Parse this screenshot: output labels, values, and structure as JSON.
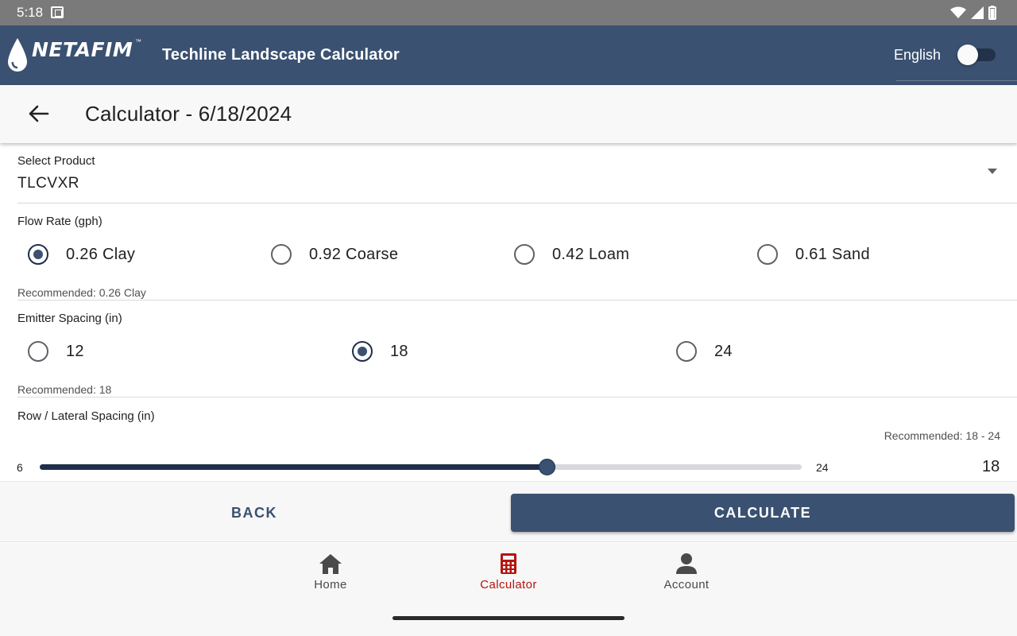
{
  "status_bar": {
    "time": "5:18"
  },
  "app_bar": {
    "logo_text": "NETAFIM",
    "logo_tm": "™",
    "title": "Techline Landscape Calculator",
    "language_label": "English"
  },
  "page": {
    "title": "Calculator - 6/18/2024"
  },
  "product": {
    "label": "Select Product",
    "value": "TLCVXR"
  },
  "flow_rate": {
    "label": "Flow Rate (gph)",
    "options": [
      {
        "label": "0.26 Clay",
        "checked": true
      },
      {
        "label": "0.92 Coarse",
        "checked": false
      },
      {
        "label": "0.42 Loam",
        "checked": false
      },
      {
        "label": "0.61 Sand",
        "checked": false
      }
    ],
    "recommended": "Recommended: 0.26 Clay"
  },
  "emitter_spacing": {
    "label": "Emitter Spacing (in)",
    "options": [
      {
        "label": "12",
        "checked": false
      },
      {
        "label": "18",
        "checked": true
      },
      {
        "label": "24",
        "checked": false
      }
    ],
    "recommended": "Recommended: 18"
  },
  "row_spacing": {
    "label": "Row / Lateral Spacing (in)",
    "recommended": "Recommended: 18 - 24",
    "min": "6",
    "max": "24",
    "value": "18"
  },
  "actions": {
    "back": "BACK",
    "calculate": "CALCULATE"
  },
  "bottom_nav": {
    "items": [
      {
        "label": "Home",
        "icon": "home-icon",
        "active": false
      },
      {
        "label": "Calculator",
        "icon": "calculator-icon",
        "active": true
      },
      {
        "label": "Account",
        "icon": "account-icon",
        "active": false
      }
    ]
  },
  "colors": {
    "primary": "#3a5171",
    "accent_active": "#b5140f",
    "status_bar": "#7a7a7a"
  }
}
